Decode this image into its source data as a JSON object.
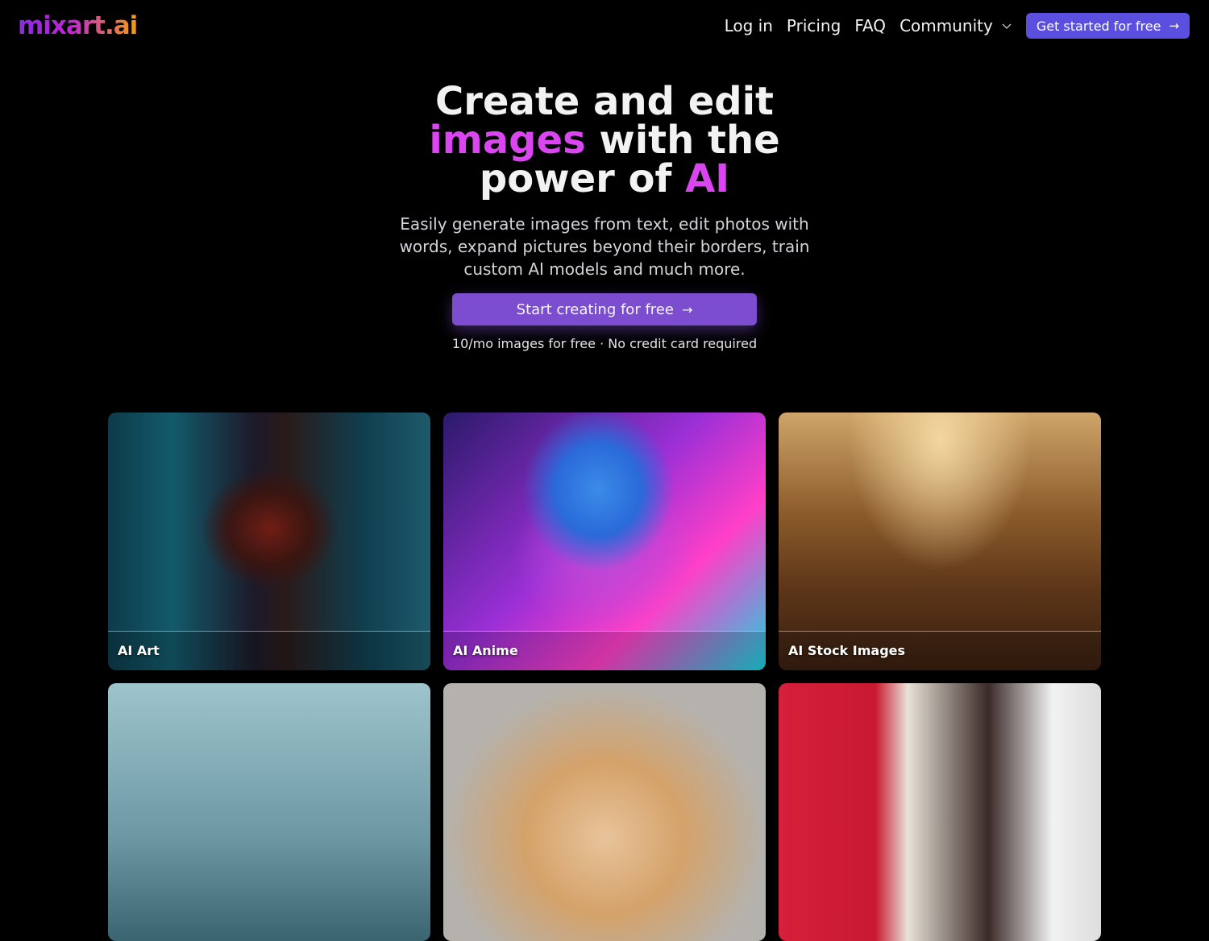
{
  "header": {
    "logo": "mixart.ai",
    "nav": {
      "login": "Log in",
      "pricing": "Pricing",
      "faq": "FAQ",
      "community": "Community",
      "cta": "Get started for free",
      "cta_arrow": "→"
    }
  },
  "hero": {
    "title_line1": "Create and edit",
    "title_highlight1": "images",
    "title_line2_rest": " with the",
    "title_line3_start": "power of ",
    "title_highlight2": "AI",
    "subtitle": "Easily generate images from text, edit photos with words, expand pictures beyond their borders, train custom AI models and much more.",
    "button": "Start creating for free",
    "button_arrow": "→",
    "note": "10/mo images for free · No credit card required"
  },
  "gallery": [
    {
      "label": "AI Art"
    },
    {
      "label": "AI Anime"
    },
    {
      "label": "AI Stock Images"
    },
    {
      "label": ""
    },
    {
      "label": ""
    },
    {
      "label": ""
    }
  ],
  "colors": {
    "accent": "#5b4fe0",
    "hero_button": "#7c4dcf",
    "highlight": "#d946ef"
  }
}
